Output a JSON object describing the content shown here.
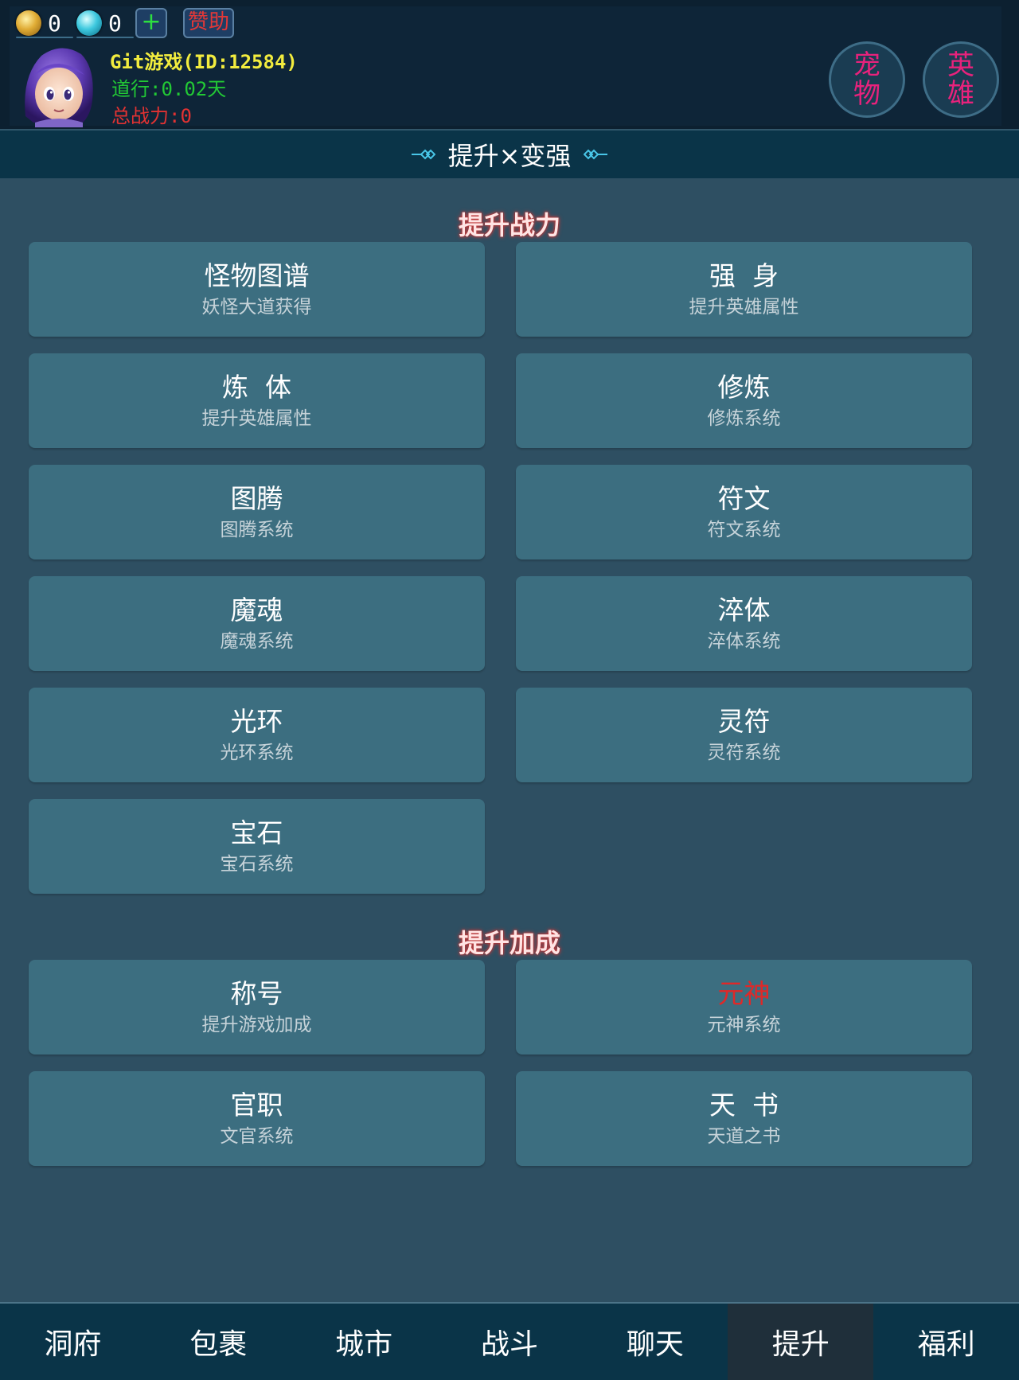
{
  "colors": {
    "page_bg": "#2e4f62",
    "header_bg": "#0c2030",
    "card_bg": "#3c6e80",
    "title_strip_bg": "#0a3448",
    "nav_bg": "#0a3448",
    "nav_active_bg": "#1f2f3a",
    "name_yellow": "#f2ec3e",
    "dao_green": "#22c935",
    "power_red": "#e23232",
    "pet_hero_pink": "#e8227c",
    "section_glow": "#c83a3a"
  },
  "header": {
    "currencies": [
      {
        "icon": "gold-coin-icon",
        "amount": "0"
      },
      {
        "icon": "jade-orb-icon",
        "amount": "0"
      }
    ],
    "add_label": "+",
    "sponsor_label": "赞助",
    "player": {
      "avatar_icon": "player-avatar",
      "name": "Git游戏(ID:12584)",
      "dao": "道行:0.02天",
      "power": "总战力:0"
    },
    "pet_button": {
      "line1": "宠",
      "line2": "物"
    },
    "hero_button": {
      "line1": "英",
      "line2": "雄"
    }
  },
  "page_title": "提升×变强",
  "sections": [
    {
      "title": "提升战力",
      "items": [
        {
          "title": "怪物图谱",
          "subtitle": "妖怪大道获得"
        },
        {
          "title": "强  身",
          "subtitle": "提升英雄属性"
        },
        {
          "title": "炼  体",
          "subtitle": "提升英雄属性"
        },
        {
          "title": "修炼",
          "subtitle": "修炼系统"
        },
        {
          "title": "图腾",
          "subtitle": "图腾系统"
        },
        {
          "title": "符文",
          "subtitle": "符文系统"
        },
        {
          "title": "魔魂",
          "subtitle": "魔魂系统"
        },
        {
          "title": "淬体",
          "subtitle": "淬体系统"
        },
        {
          "title": "光环",
          "subtitle": "光环系统"
        },
        {
          "title": "灵符",
          "subtitle": "灵符系统"
        },
        {
          "title": "宝石",
          "subtitle": "宝石系统"
        }
      ]
    },
    {
      "title": "提升加成",
      "items": [
        {
          "title": "称号",
          "subtitle": "提升游戏加成"
        },
        {
          "title": "元神",
          "subtitle": "元神系统",
          "highlight_color": "#e02828"
        },
        {
          "title": "官职",
          "subtitle": "文官系统"
        },
        {
          "title": "天  书",
          "subtitle": "天道之书"
        }
      ]
    }
  ],
  "nav": {
    "active_index": 5,
    "tabs": [
      "洞府",
      "包裹",
      "城市",
      "战斗",
      "聊天",
      "提升",
      "福利"
    ]
  }
}
